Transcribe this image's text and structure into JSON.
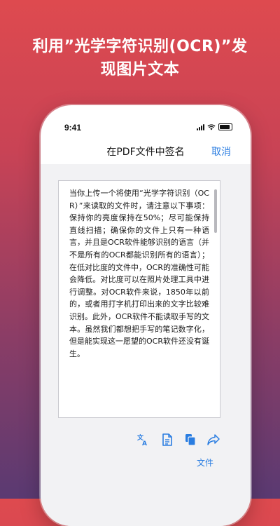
{
  "headline": {
    "line1": "利用”光学字符识别(OCR)”发",
    "line2": "现图片文本"
  },
  "status_bar": {
    "time": "9:41"
  },
  "nav": {
    "title": "在PDF文件中签名",
    "cancel_label": "取消"
  },
  "document": {
    "text": "当你上传一个将使用“光学字符识别（OCR）”来读取的文件时，请注意以下事项：保持你的亮度保持在50%；尽可能保持直线扫描；确保你的文件上只有一种语言，并且是OCR软件能够识别的语言（并不是所有的OCR都能识别所有的语言）；在低对比度的文件中，OCR的准确性可能会降低。对比度可以在照片处理工具中进行调整。对OCR软件来说，1850年以前的，或者用打字机打印出来的文字比较难识别。此外，OCR软件不能读取手写的文本。虽然我们都想把手写的笔记数字化，但是能实现这一愿望的OCR软件还没有诞生。"
  },
  "toolbar": {
    "icons": [
      "translate-icon",
      "document-icon",
      "copy-icon",
      "share-icon"
    ],
    "file_label": "文件"
  },
  "colors": {
    "accent": "#2a7de1",
    "gradient_top": "#de4a4f",
    "gradient_bottom": "#5a3a72"
  }
}
